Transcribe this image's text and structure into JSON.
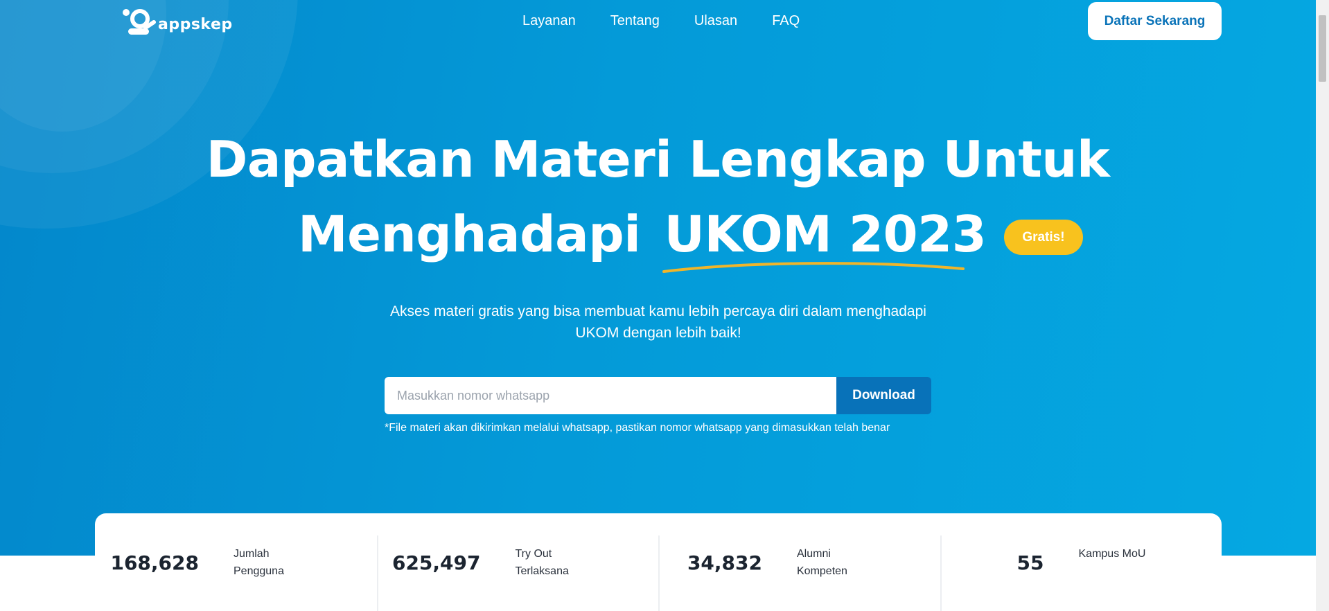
{
  "brand": {
    "name": "appskep"
  },
  "nav": {
    "items": [
      {
        "label": "Layanan"
      },
      {
        "label": "Tentang"
      },
      {
        "label": "Ulasan"
      },
      {
        "label": "FAQ"
      }
    ],
    "cta_label": "Daftar Sekarang"
  },
  "hero": {
    "headline_line1": "Dapatkan Materi Lengkap Untuk",
    "headline_line2_prefix": "Menghadapi",
    "headline_highlight": "UKOM 2023",
    "badge": "Gratis!",
    "subheadline": "Akses materi gratis yang bisa membuat kamu lebih percaya diri dalam menghadapi UKOM dengan lebih baik!"
  },
  "form": {
    "placeholder": "Masukkan nomor whatsapp",
    "value": "",
    "button_label": "Download",
    "note": "*File materi akan dikirimkan melalui whatsapp, pastikan nomor whatsapp yang dimasukkan telah benar"
  },
  "stats": [
    {
      "value": "168,628",
      "label": "Jumlah Pengguna"
    },
    {
      "value": "625,497",
      "label": "Try Out Terlaksana"
    },
    {
      "value": "34,832",
      "label": "Alumni Kompeten"
    },
    {
      "value": "55",
      "label": "Kampus MoU"
    }
  ],
  "colors": {
    "hero_start": "#0387cb",
    "hero_end": "#05a8e2",
    "accent_badge": "#f8c21e",
    "cta_text": "#0a73b8",
    "download_button": "#0872b9"
  }
}
